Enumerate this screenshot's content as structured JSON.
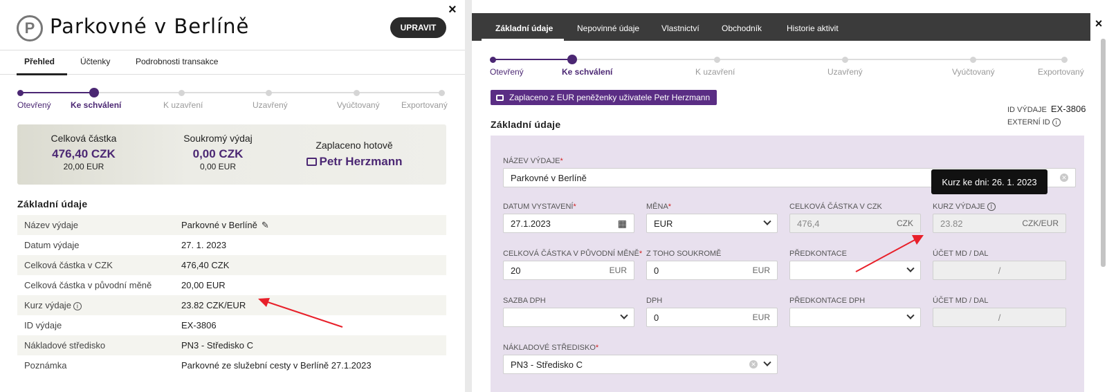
{
  "left": {
    "logo_letter": "P",
    "title": "Parkovné v Berlíně",
    "edit_button": "UPRAVIT",
    "close": "×",
    "tabs": [
      "Přehled",
      "Účtenky",
      "Podrobnosti transakce"
    ],
    "steps": [
      "Otevřený",
      "Ke schválení",
      "K uzavření",
      "Uzavřený",
      "Vyúčtovaný",
      "Exportovaný"
    ],
    "summary": {
      "total_label": "Celková částka",
      "total_czk": "476,40 CZK",
      "total_eur": "20,00 EUR",
      "private_label": "Soukromý výdaj",
      "private_czk": "0,00 CZK",
      "private_eur": "0,00 EUR",
      "paid_cash_label": "Zaplaceno hotově",
      "paid_by": "Petr Herzmann"
    },
    "section_title": "Základní údaje",
    "details": [
      {
        "label": "Název výdaje",
        "value": "Parkovné v Berlíně"
      },
      {
        "label": "Datum výdaje",
        "value": "27. 1. 2023"
      },
      {
        "label": "Celková částka v CZK",
        "value": "476,40 CZK"
      },
      {
        "label": "Celková částka v původní měně",
        "value": "20,00 EUR"
      },
      {
        "label": "Kurz výdaje",
        "value": "23.82 CZK/EUR"
      },
      {
        "label": "ID výdaje",
        "value": "EX-3806"
      },
      {
        "label": "Nákladové středisko",
        "value": "PN3 - Středisko C"
      },
      {
        "label": "Poznámka",
        "value": "Parkovné ze služební cesty v Berlíně 27.1.2023"
      }
    ]
  },
  "right": {
    "close": "×",
    "tabs": [
      "Základní údaje",
      "Nepovinné údaje",
      "Vlastnictví",
      "Obchodník",
      "Historie aktivit"
    ],
    "steps": [
      "Otevřený",
      "Ke schválení",
      "K uzavření",
      "Uzavřený",
      "Vyúčtovaný",
      "Exportovaný"
    ],
    "wallet_badge": "Zaplaceno z EUR peněženky uživatele Petr Herzmann",
    "section_title": "Základní údaje",
    "id_label": "ID VÝDAJE",
    "id_value": "EX-3806",
    "external_id_label": "EXTERNÍ ID",
    "tooltip": "Kurz ke dni: 26. 1. 2023",
    "fields": {
      "name_label": "NÁZEV VÝDAJE",
      "name_value": "Parkovné v Berlíně",
      "date_label": "DATUM VYSTAVENÍ",
      "date_value": "27.1.2023",
      "currency_label": "MĚNA",
      "currency_value": "EUR",
      "total_czk_label": "CELKOVÁ ČÁSTKA V CZK",
      "total_czk_value": "476,4",
      "total_czk_unit": "CZK",
      "rate_label": "KURZ VÝDAJE",
      "rate_value": "23.82",
      "rate_unit": "CZK/EUR",
      "orig_label": "CELKOVÁ ČÁSTKA V PŮVODNÍ MĚNĚ",
      "orig_value": "20",
      "orig_unit": "EUR",
      "private_label": "Z TOHO SOUKROMĚ",
      "private_value": "0",
      "private_unit": "EUR",
      "predkontace_label": "PŘEDKONTACE",
      "ucet_label": "ÚČET MD / DAL",
      "ucet_sep": "/",
      "vat_rate_label": "SAZBA DPH",
      "vat_label": "DPH",
      "vat_value": "0",
      "vat_unit": "EUR",
      "predkontace_dph_label": "PŘEDKONTACE DPH",
      "ucet2_label": "ÚČET MD / DAL",
      "ucet2_sep": "/",
      "cost_center_label": "NÁKLADOVÉ STŘEDISKO",
      "cost_center_value": "PN3 - Středisko C"
    }
  },
  "colors": {
    "accent": "#4b2773",
    "badge": "#5a2d84",
    "arrow": "#e8202a"
  }
}
